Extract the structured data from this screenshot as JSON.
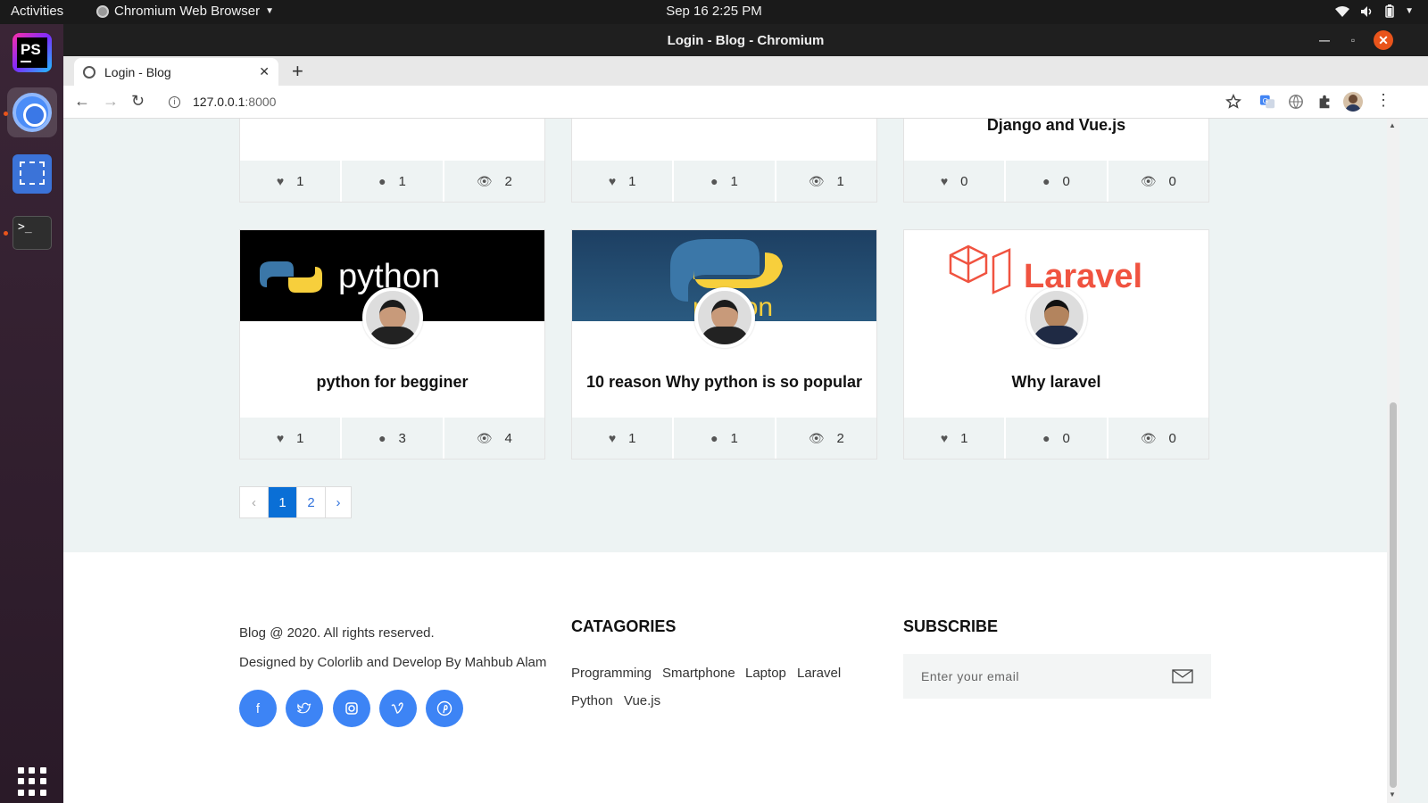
{
  "topbar": {
    "activities": "Activities",
    "app_name": "Chromium Web Browser",
    "clock": "Sep 16  2:25 PM"
  },
  "dock": {
    "phpstorm_label": "PS"
  },
  "window": {
    "title": "Login - Blog - Chromium"
  },
  "browser": {
    "tab_title": "Login - Blog",
    "url_host": "127.0.0.1",
    "url_port": ":8000"
  },
  "posts_top": [
    {
      "title": "",
      "likes": "1",
      "comments": "1",
      "views": "2"
    },
    {
      "title": "",
      "likes": "1",
      "comments": "1",
      "views": "1"
    },
    {
      "title": "Django and Vue.js",
      "likes": "0",
      "comments": "0",
      "views": "0"
    }
  ],
  "posts": [
    {
      "title": "python for begginer",
      "image_text": "python",
      "likes": "1",
      "comments": "3",
      "views": "4"
    },
    {
      "title": "10 reason Why python is so popular",
      "image_text": "python",
      "likes": "1",
      "comments": "1",
      "views": "2"
    },
    {
      "title": "Why laravel",
      "image_text": "Laravel",
      "likes": "1",
      "comments": "0",
      "views": "0"
    }
  ],
  "pagination": {
    "prev": "‹",
    "pages": [
      "1",
      "2"
    ],
    "next": "›"
  },
  "footer": {
    "copyright": "Blog @ 2020. All rights reserved.",
    "credit": "Designed by Colorlib and Develop By Mahbub Alam",
    "categories_heading": "CATAGORIES",
    "categories": [
      "Programming",
      "Smartphone",
      "Laptop",
      "Laravel",
      "Python",
      "Vue.js"
    ],
    "subscribe_heading": "SUBSCRIBE",
    "email_placeholder": "Enter your email"
  },
  "colors": {
    "accent": "#0a6fd6",
    "social": "#3d84f5",
    "page_bg": "#edf3f3"
  }
}
